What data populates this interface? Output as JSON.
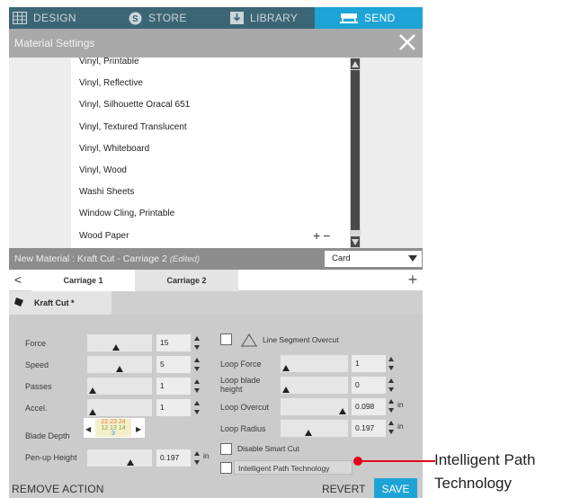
{
  "topnav": {
    "design": "DESIGN",
    "store": "STORE",
    "library": "LIBRARY",
    "send": "SEND"
  },
  "header": {
    "title": "Material Settings"
  },
  "material_list": {
    "items": [
      "Vinyl, Printable",
      "Vinyl, Reflective",
      "Vinyl, Silhouette Oracal 651",
      "Vinyl, Textured Translucent",
      "Vinyl, Whiteboard",
      "Vinyl, Wood",
      "Washi Sheets",
      "Window Cling, Printable",
      "Wood Paper"
    ],
    "add_label": "+",
    "remove_label": "−"
  },
  "new_material": {
    "label": "New Material : Kraft Cut - Carriage 2",
    "edited": "(Edited)",
    "select_value": "Card"
  },
  "carriage": {
    "prev": "<",
    "tab1": "Carriage 1",
    "tab2": "Carriage 2",
    "add": "+"
  },
  "tool": {
    "name": "Kraft Cut *"
  },
  "settings": {
    "force": {
      "label": "Force",
      "value": "15",
      "level": 0.43
    },
    "speed": {
      "label": "Speed",
      "value": "5",
      "level": 0.5
    },
    "passes": {
      "label": "Passes",
      "value": "1",
      "level": 0.0
    },
    "accel": {
      "label": "Accel.",
      "value": "1",
      "level": 0.0
    },
    "blade_depth": {
      "label": "Blade Depth",
      "row1": "22 23 24",
      "row2": "12 13 14",
      "row3": "3"
    },
    "penup": {
      "label": "Pen-up Height",
      "value": "0.197",
      "unit": "in",
      "level": 0.7
    },
    "line_segment_overcut": {
      "label": "Line Segment Overcut",
      "checked": false
    },
    "loop_force": {
      "label": "Loop Force",
      "value": "1",
      "level": 0.0
    },
    "loop_blade_height": {
      "label": "Loop blade height",
      "value": "0",
      "level": 0.0
    },
    "loop_overcut": {
      "label": "Loop Overcut",
      "value": "0.098",
      "unit": "in",
      "level": 1.0
    },
    "loop_radius": {
      "label": "Loop Radius",
      "value": "0.197",
      "unit": "in",
      "level": 0.4
    },
    "disable_smart_cut": {
      "label": "Disable Smart Cut",
      "checked": false
    },
    "intelligent_path": {
      "label": "Intelligent Path Technology",
      "checked": false
    }
  },
  "bottom": {
    "remove_action": "REMOVE ACTION",
    "revert": "REVERT",
    "save": "SAVE"
  },
  "callout": {
    "text": "Intelligent Path Technology"
  },
  "colors": {
    "nav_bg": "#3c6575",
    "accent": "#1ea3d6",
    "callout": "#e0001a"
  },
  "icons": {
    "design": "grid-icon",
    "store": "store-s-icon",
    "library": "library-download-icon",
    "send": "cutter-icon",
    "close": "close-icon",
    "tool": "blade-icon"
  }
}
